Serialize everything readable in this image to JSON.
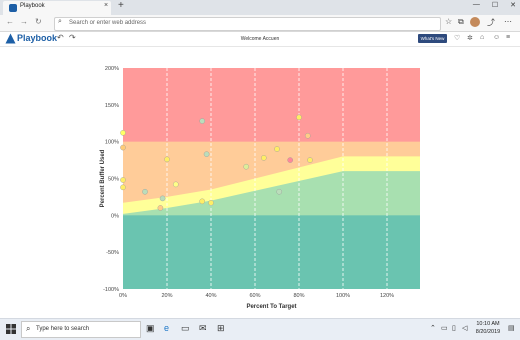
{
  "browser": {
    "tab_title": "Playbook",
    "tab_close": "×",
    "new_tab": "+",
    "window_controls": [
      "—",
      "☐",
      "✕"
    ],
    "address_placeholder": "Search or enter web address",
    "nav_icons": [
      "back-icon",
      "forward-icon",
      "refresh-icon"
    ]
  },
  "app": {
    "logo": "Playbook",
    "welcome": "Welcome Accuen",
    "whats_new": "What's New",
    "brand_color": "#1d5fa6",
    "button_color": "#2e4a7d"
  },
  "chart_data": {
    "type": "scatter",
    "xlabel": "Percent To Target",
    "ylabel": "Percent Buffer Used",
    "xlim": [
      0,
      135
    ],
    "ylim": [
      -100,
      200
    ],
    "x_ticks": [
      "0%",
      "20%",
      "40%",
      "60%",
      "80%",
      "100%",
      "120%"
    ],
    "y_ticks": [
      "200%",
      "150%",
      "100%",
      "50%",
      "0%",
      "-50%",
      "-100%"
    ],
    "zones": {
      "red": "#ff9a9a",
      "orange": "#ffcc99",
      "yellow": "#ffff99",
      "light_green": "#a8e0b0",
      "teal": "#6ac4b0"
    },
    "zone_boundaries": {
      "green_top": [
        [
          0,
          2
        ],
        [
          20,
          10
        ],
        [
          40,
          20
        ],
        [
          100,
          60
        ],
        [
          135,
          60
        ]
      ],
      "yellow_top": [
        [
          0,
          17
        ],
        [
          20,
          25
        ],
        [
          40,
          35
        ],
        [
          100,
          80
        ],
        [
          135,
          80
        ]
      ],
      "orange_top": 100
    },
    "points": [
      {
        "x": 0,
        "y": 112,
        "color": "#ffff66"
      },
      {
        "x": 0,
        "y": 92,
        "color": "#ffcc77"
      },
      {
        "x": 0,
        "y": 48,
        "color": "#ffee66"
      },
      {
        "x": 0,
        "y": 38,
        "color": "#ffee66"
      },
      {
        "x": 10,
        "y": 32,
        "color": "#bbddbb"
      },
      {
        "x": 17,
        "y": 10,
        "color": "#ffcc88"
      },
      {
        "x": 18,
        "y": 23,
        "color": "#bbddbb"
      },
      {
        "x": 20,
        "y": 76,
        "color": "#ffee66"
      },
      {
        "x": 24,
        "y": 42,
        "color": "#ffff88"
      },
      {
        "x": 36,
        "y": 128,
        "color": "#bbddbb"
      },
      {
        "x": 36,
        "y": 19,
        "color": "#ffee66"
      },
      {
        "x": 38,
        "y": 83,
        "color": "#bbddbb"
      },
      {
        "x": 40,
        "y": 17,
        "color": "#ffee66"
      },
      {
        "x": 56,
        "y": 66,
        "color": "#ddee99"
      },
      {
        "x": 64,
        "y": 78,
        "color": "#ffee66"
      },
      {
        "x": 70,
        "y": 90,
        "color": "#ffee66"
      },
      {
        "x": 71,
        "y": 32,
        "color": "#bbddbb"
      },
      {
        "x": 76,
        "y": 75,
        "color": "#ff8899"
      },
      {
        "x": 80,
        "y": 133,
        "color": "#ffee66"
      },
      {
        "x": 84,
        "y": 108,
        "color": "#ffcc88"
      },
      {
        "x": 85,
        "y": 75,
        "color": "#ffee66"
      }
    ]
  },
  "taskbar": {
    "search_placeholder": "Type here to search",
    "time": "10:10 AM",
    "date": "8/20/2019"
  }
}
